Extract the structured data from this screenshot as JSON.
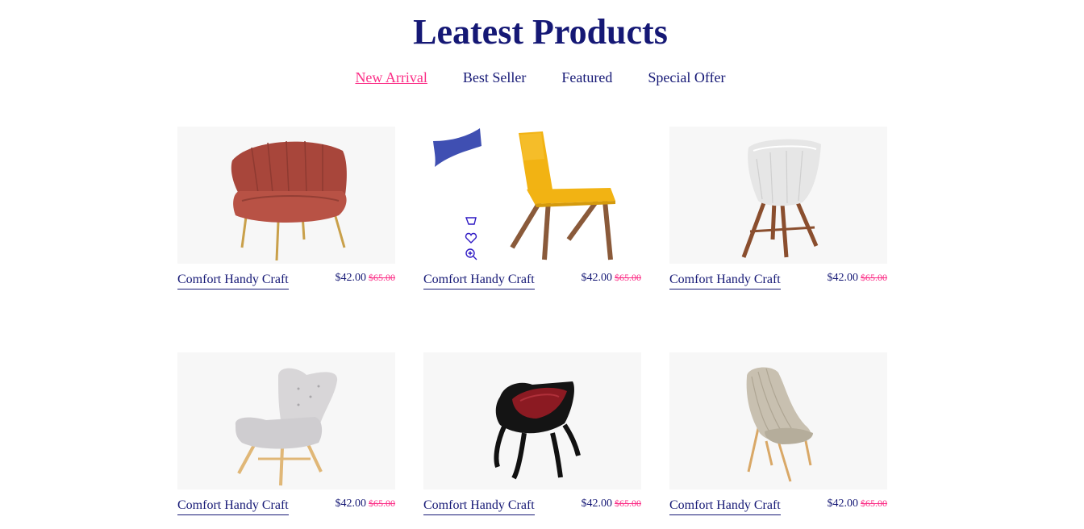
{
  "heading": "Leatest Products",
  "tabs": [
    {
      "label": "New Arrival",
      "active": true
    },
    {
      "label": "Best Seller",
      "active": false
    },
    {
      "label": "Featured",
      "active": false
    },
    {
      "label": "Special Offer",
      "active": false
    }
  ],
  "products": [
    {
      "name": "Comfort Handy Craft",
      "price": "$42.00",
      "old_price": "$65.00",
      "image": "rust-velvet-armchair"
    },
    {
      "name": "Comfort Handy Craft",
      "price": "$42.00",
      "old_price": "$65.00",
      "image": "yellow-wood-chair"
    },
    {
      "name": "Comfort Handy Craft",
      "price": "$42.00",
      "old_price": "$65.00",
      "image": "white-shell-chair"
    },
    {
      "name": "Comfort Handy Craft",
      "price": "$42.00",
      "old_price": "$65.00",
      "image": "grey-wingback-chair"
    },
    {
      "name": "Comfort Handy Craft",
      "price": "$42.00",
      "old_price": "$65.00",
      "image": "black-red-sculpted-chair"
    },
    {
      "name": "Comfort Handy Craft",
      "price": "$42.00",
      "old_price": "$65.00",
      "image": "beige-woven-chair"
    }
  ],
  "hover_actions": [
    "cart-icon",
    "heart-icon",
    "zoom-in-icon"
  ],
  "colors": {
    "primary": "#151875",
    "accent": "#fb2e86",
    "card_bg": "#f7f7f7",
    "flag": "#3f4fb2"
  }
}
